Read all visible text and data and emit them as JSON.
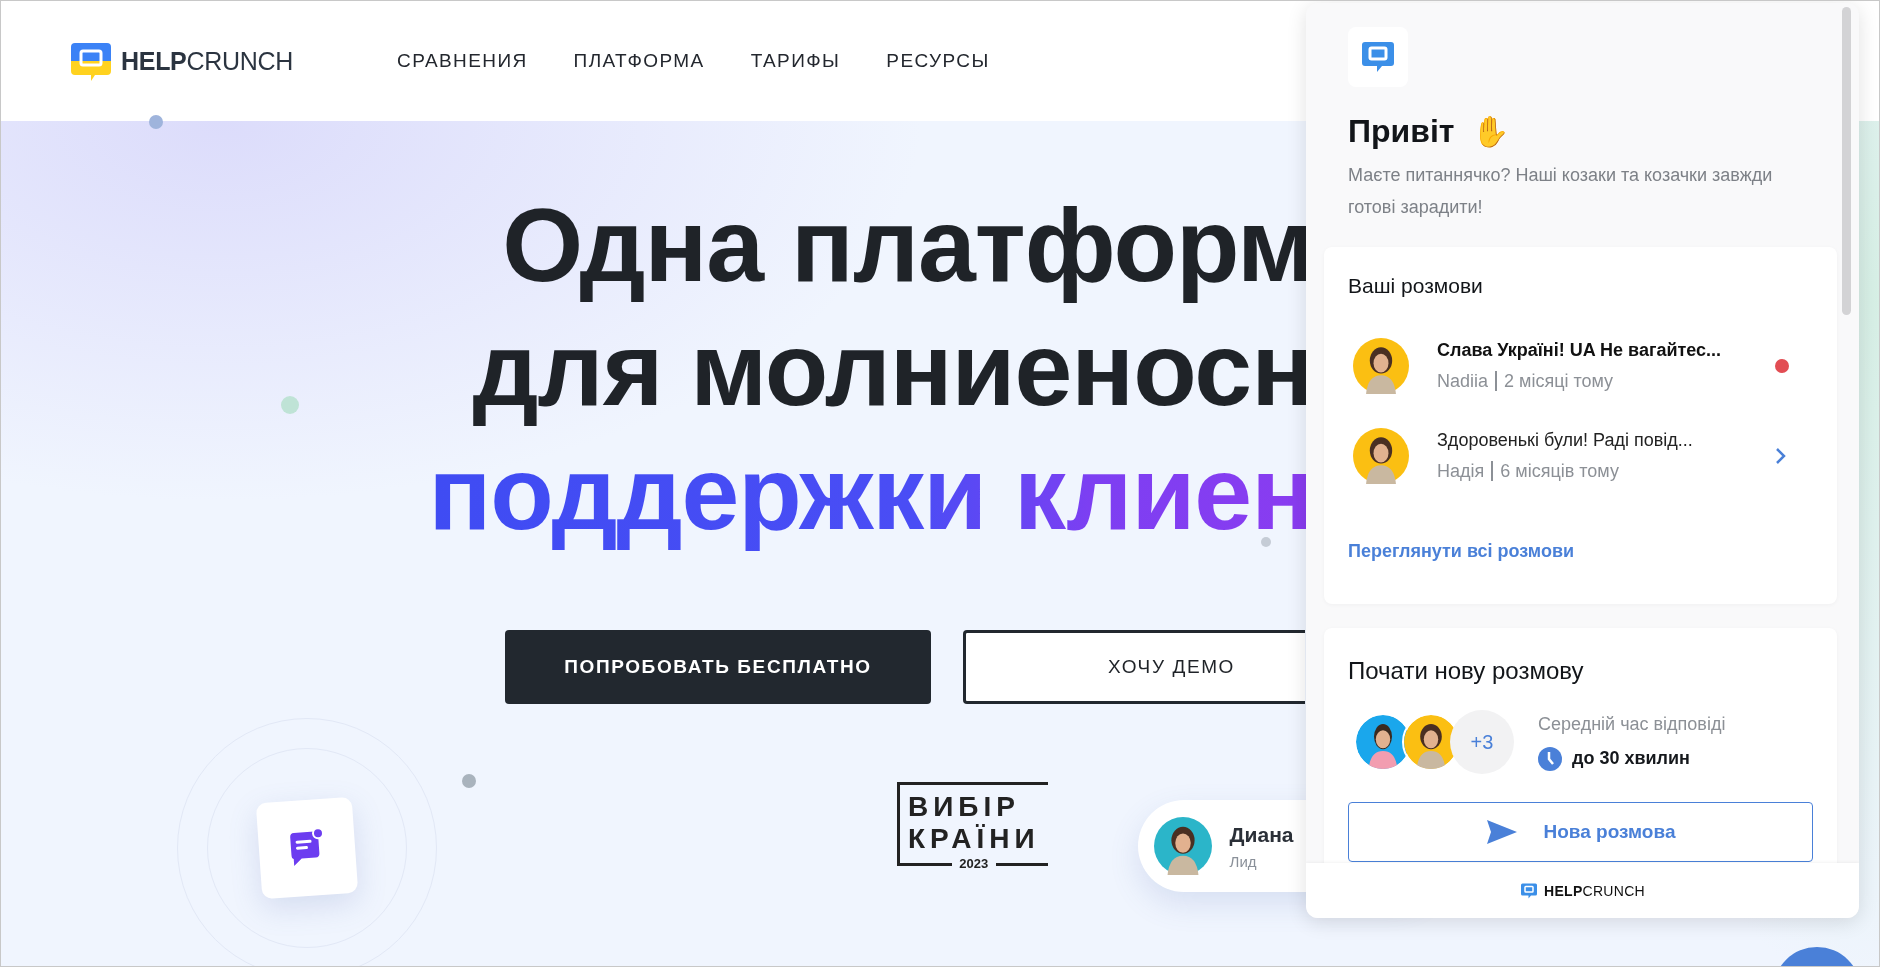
{
  "header": {
    "logo": {
      "bold": "HELP",
      "light": "CRUNCH"
    },
    "nav": [
      {
        "label": "СРАВНЕНИЯ"
      },
      {
        "label": "ПЛАТФОРМА"
      },
      {
        "label": "ТАРИФЫ"
      },
      {
        "label": "РЕСУРСЫ"
      }
    ]
  },
  "hero": {
    "headline": [
      {
        "text": "Одна платформ",
        "kind": "plain"
      },
      {
        "text": "для молниеносн",
        "kind": "plain"
      },
      {
        "text": "поддержки клиен",
        "kind": "gradient"
      }
    ],
    "buttons": [
      {
        "label": "ПОПРОБОВАТЬ БЕСПЛАТНО",
        "kind": "primary"
      },
      {
        "label": "ХОЧУ ДЕМО",
        "kind": "outline"
      }
    ],
    "award": {
      "lines": [
        "ВИБІР",
        "КРАЇНИ"
      ],
      "year": "2023"
    },
    "contact_card": {
      "name": "Диана",
      "role": "Лид"
    }
  },
  "chat_widget": {
    "greeting": "Привіт",
    "greeting_emoji": "✋",
    "subtitle": "Маєте питаннячко? Наші козаки та козачки завжди готові зарадити!",
    "conversations": {
      "title": "Ваші розмови",
      "items": [
        {
          "message": "Слава Україні! UA Не вагайтес...",
          "author": "Nadiia",
          "time": "2 місяці тому",
          "unread": true
        },
        {
          "message": "Здоровенькі були!   Раді повід...",
          "author": "Надія",
          "time": "6 місяців тому",
          "unread": false
        }
      ],
      "view_all": "Переглянути всі розмови"
    },
    "new_conversation": {
      "title": "Почати нову розмову",
      "team_extra": "+3",
      "response_label": "Середній час відповіді",
      "response_time": "до 30 хвилин",
      "button": "Нова розмова"
    },
    "footer": {
      "bold": "HELP",
      "light": "CRUNCH"
    }
  }
}
